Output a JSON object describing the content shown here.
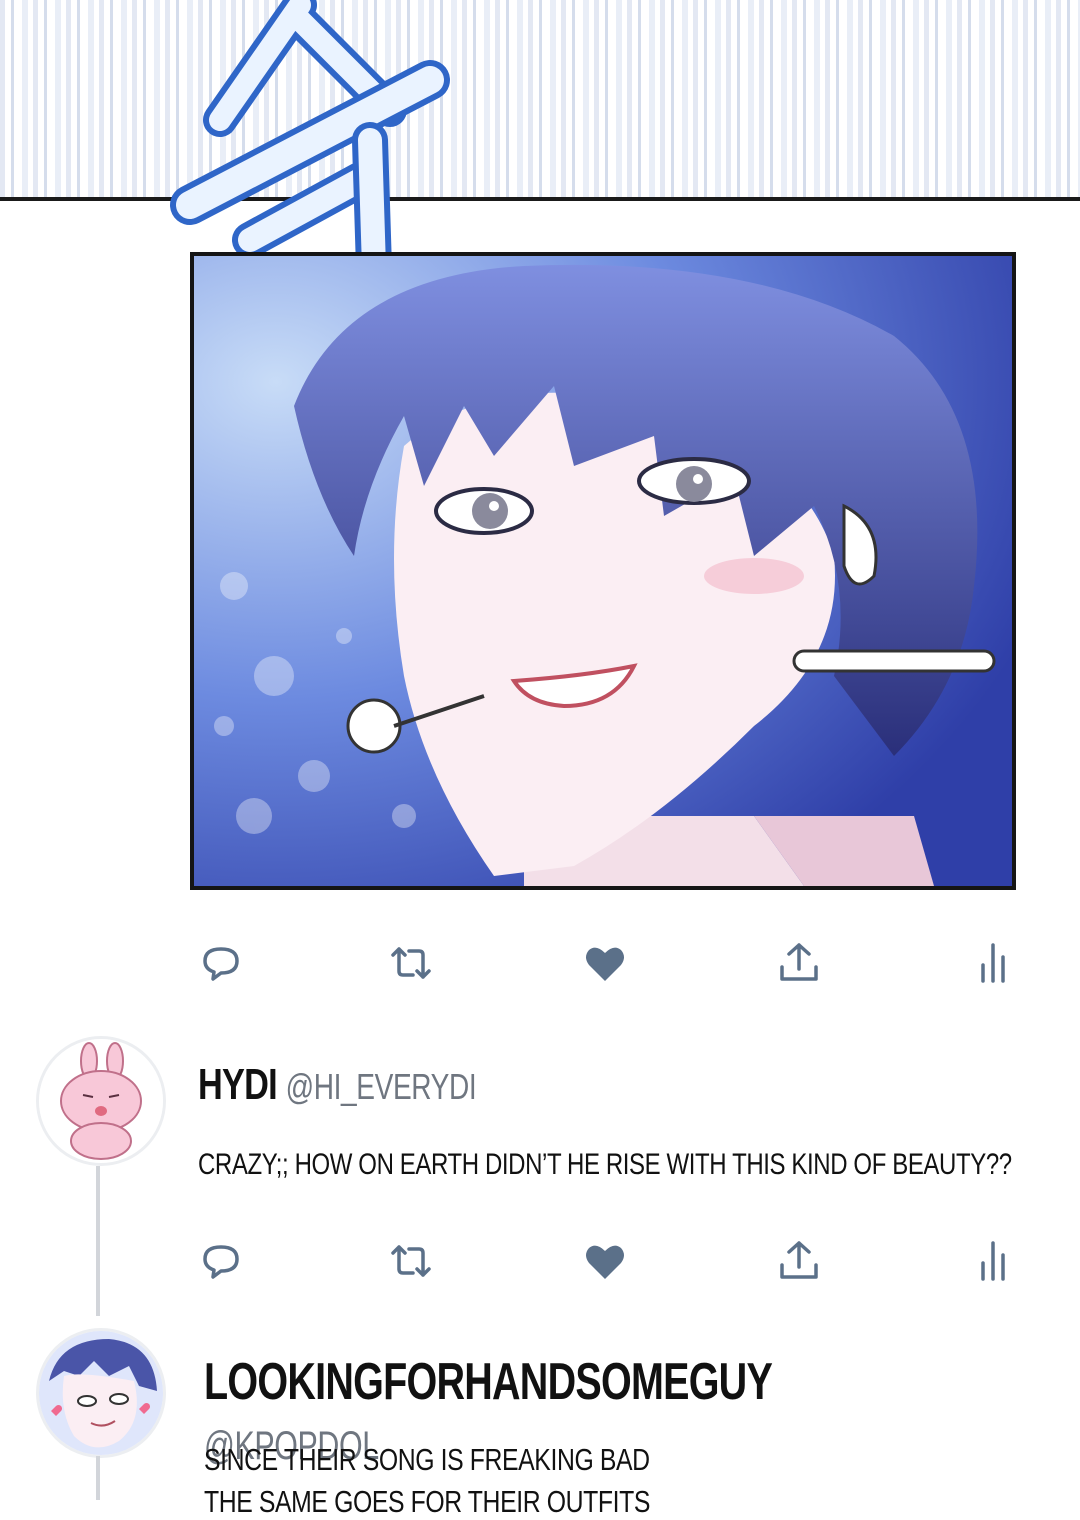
{
  "sound_effect": "슥",
  "post": {
    "actions": [
      "reply-icon",
      "retweet-icon",
      "heart-icon",
      "share-icon",
      "stats-icon"
    ],
    "icon_color": "#5b7089"
  },
  "replies": [
    {
      "display_name": "HYDI",
      "handle": "@HI_EVERYDI",
      "text": "CRAZY;; HOW ON EARTH DIDN’T HE RISE WITH THIS KIND OF BEAUTY??"
    },
    {
      "display_name": "LOOKINGFORHANDSOMEGUY",
      "handle": "@KPOPDOL",
      "text_line1": "SINCE THEIR SONG IS FREAKING BAD",
      "text_line2": "THE SAME GOES FOR THEIR OUTFITS"
    }
  ]
}
